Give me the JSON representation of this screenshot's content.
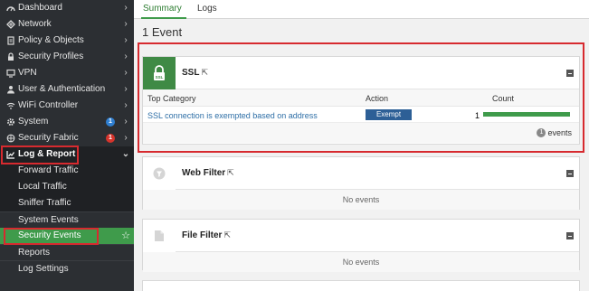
{
  "sidebar": {
    "items": [
      {
        "label": "Dashboard",
        "icon": "dashboard-icon",
        "chevron": "›"
      },
      {
        "label": "Network",
        "icon": "network-icon",
        "chevron": "›"
      },
      {
        "label": "Policy & Objects",
        "icon": "policy-icon",
        "chevron": "›"
      },
      {
        "label": "Security Profiles",
        "icon": "lock-icon",
        "chevron": "›"
      },
      {
        "label": "VPN",
        "icon": "monitor-icon",
        "chevron": "›"
      },
      {
        "label": "User & Authentication",
        "icon": "user-icon",
        "chevron": "›"
      },
      {
        "label": "WiFi Controller",
        "icon": "wifi-icon",
        "chevron": "›"
      },
      {
        "label": "System",
        "icon": "gear-icon",
        "badge": "1",
        "chevron": "›"
      },
      {
        "label": "Security Fabric",
        "icon": "fabric-icon",
        "badge": "1",
        "chevron": "›"
      },
      {
        "label": "Log & Report",
        "icon": "chart-icon",
        "chevron": "⌄"
      }
    ],
    "sub_items": [
      {
        "label": "Forward Traffic"
      },
      {
        "label": "Local Traffic"
      },
      {
        "label": "Sniffer Traffic"
      },
      {
        "label": "System Events"
      },
      {
        "label": "Security Events"
      },
      {
        "label": "Reports"
      },
      {
        "label": "Log Settings"
      }
    ],
    "star": "☆"
  },
  "tabs": [
    {
      "label": "Summary"
    },
    {
      "label": "Logs"
    }
  ],
  "event_count": "1 Event",
  "ssl_card": {
    "title": "SSL",
    "icon_text": "SSL",
    "ext_icon": "⇱",
    "collapse": "−",
    "columns": {
      "category": "Top Category",
      "action": "Action",
      "count": "Count"
    },
    "row": {
      "category": "SSL connection is exempted based on address",
      "action": "Exempt",
      "count": "1",
      "bar_fraction": 1.0
    },
    "footer_count": "1",
    "footer_label": "events"
  },
  "web_filter_card": {
    "title": "Web Filter",
    "no_events": "No events"
  },
  "file_filter_card": {
    "title": "File Filter",
    "no_events": "No events"
  },
  "colors": {
    "sidebar_bg": "#2c2f33",
    "active_green": "#3f9b4b",
    "highlight_red": "#d72a2f",
    "link_blue": "#2d6ea6"
  }
}
